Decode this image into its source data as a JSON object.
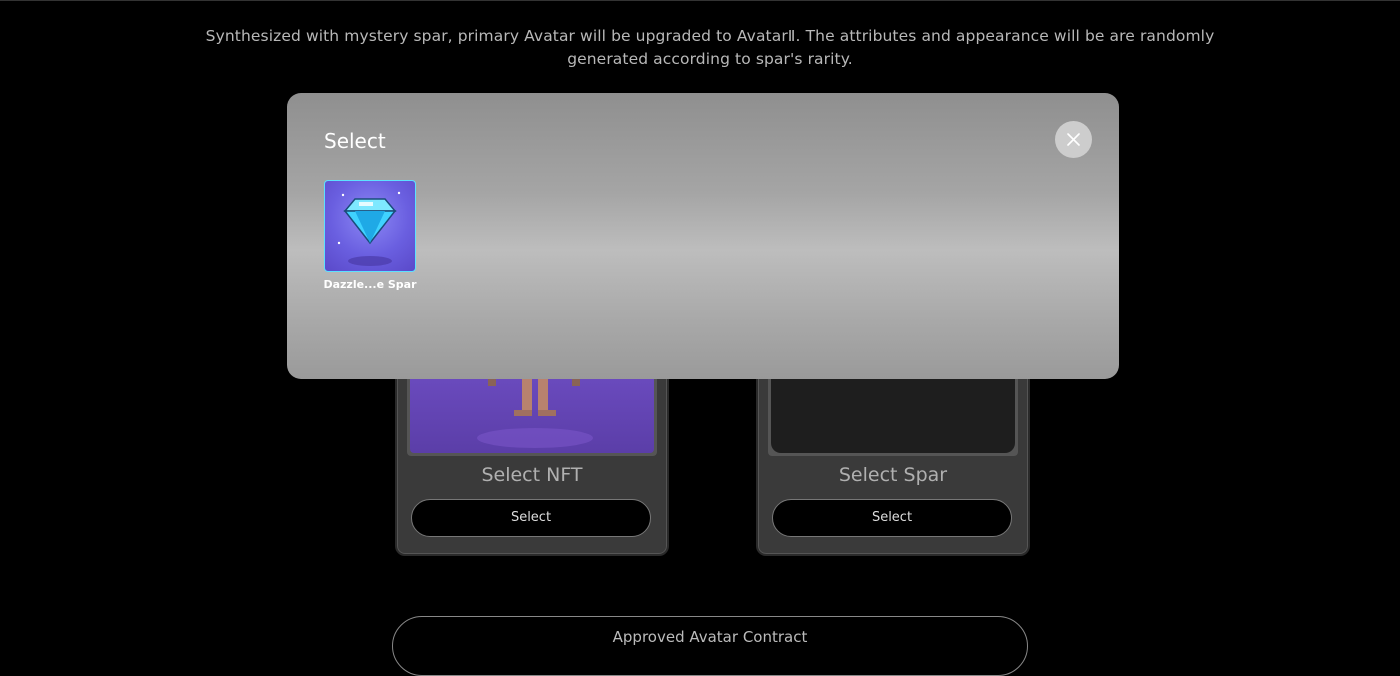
{
  "description": "Synthesized with mystery spar, primary Avatar will be upgraded to AvatarⅡ. The attributes and appearance will be are randomly generated according to spar's rarity.",
  "cards": {
    "nft": {
      "label": "Select NFT",
      "button": "Select"
    },
    "spar": {
      "label": "Select Spar",
      "button": "Select"
    }
  },
  "approve_button": "Approved Avatar Contract",
  "modal": {
    "title": "Select",
    "items": [
      {
        "name": "Dazzle...e Spar",
        "icon": "diamond-icon"
      }
    ]
  },
  "colors": {
    "background": "#000000",
    "modal_gradient_mid": "#bdbdbd",
    "selected_border": "#5ce1ff",
    "gem": "#4fd8ff"
  }
}
